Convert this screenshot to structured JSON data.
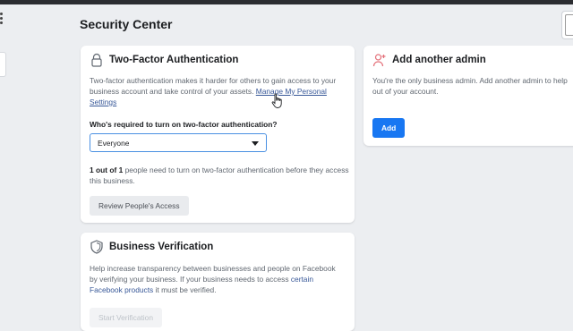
{
  "page": {
    "title": "Security Center"
  },
  "two_factor": {
    "title": "Two-Factor Authentication",
    "icon": "lock-icon",
    "description": "Two-factor authentication makes it harder for others to gain access to your business account and take control of your assets.",
    "manage_link": "Manage My Personal Settings",
    "question": "Who's required to turn on two-factor authentication?",
    "select_value": "Everyone",
    "count_bold": "1 out of 1",
    "count_rest": "people need to turn on two-factor authentication before they access this business.",
    "review_button": "Review People's Access"
  },
  "admin": {
    "title": "Add another admin",
    "icon": "add-person-icon",
    "description": "You're the only business admin. Add another admin to help out of your account.",
    "add_button": "Add"
  },
  "business_verification": {
    "title": "Business Verification",
    "icon": "shield-icon",
    "description_pre": "Help increase transparency between businesses and people on Facebook by verifying your business. If your business needs to access",
    "link": "certain Facebook products",
    "description_post": "it must be verified.",
    "start_button": "Start Verification"
  },
  "colors": {
    "accent": "#1877f2",
    "link": "#385898",
    "background": "#eceef1"
  }
}
